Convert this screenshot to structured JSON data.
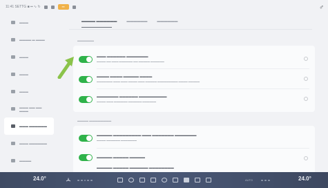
{
  "statusbar": {
    "left_text": "11:41 SETTG ■ ▪▪  ∿  ↻",
    "badge": "▪▪▪",
    "right_icon": "person-icon",
    "right_glyph": "♂"
  },
  "sidebar": {
    "items": [
      {
        "label": "▬▬▬",
        "icon": "info-icon"
      },
      {
        "label": "▬▬▬▬ ▬ ▬▬▬",
        "icon": "display-icon"
      },
      {
        "label": "▬▬▬",
        "icon": "light-icon"
      },
      {
        "label": "▬▬▬",
        "icon": "seat-icon"
      },
      {
        "label": "▬▬▬",
        "icon": "lock-icon"
      },
      {
        "label": "▬▬▬ ▬▬ ▬▬ ▬▬▬",
        "icon": "steering-icon"
      },
      {
        "label": "▬▬▬ ▬▬▬▬▬▬",
        "icon": "assist-icon"
      },
      {
        "label": "▬▬▬ ▬▬▬▬▬▬",
        "icon": "energy-icon"
      },
      {
        "label": "▬▬▬▬",
        "icon": "system-icon"
      }
    ],
    "selected_index": 6
  },
  "tabs": [
    {
      "label": "▬▬▬▬ ▬▬▬▬▬▬"
    },
    {
      "label": "▬▬▬▬▬▬"
    },
    {
      "label": "▬▬▬▬▬▬"
    }
  ],
  "groups": [
    {
      "title": "▬▬▬▬▬▬",
      "rows": [
        {
          "title": "▬▬▬ ▬▬▬▬▬▬ ▬▬▬▬▬▬▬",
          "subtitle": "▬▬▬▬ ▬▬ ▬▬▬ ▬▬▬▬▬▬ ▬▬ ▬▬▬▬▬ ▬▬▬▬▬▬",
          "enabled": true
        },
        {
          "title": "▬▬▬▬ ▬▬▬▬ ▬▬▬▬▬ ▬▬▬▬",
          "subtitle": "▬▬▬▬▬▬▬ ▬▬▬ ▬▬▬ ▬▬▬▬ ▬▬▬ ▬▬▬▬▬ ▬▬▬▬▬▬▬▬▬ ▬▬▬▬ ▬▬▬▬▬",
          "enabled": true
        },
        {
          "title": "▬▬▬▬▬▬▬ ▬▬▬▬▬▬ ▬▬▬▬▬▬▬▬▬",
          "subtitle": "▬▬▬▬ ▬▬▬ ▬▬▬▬▬▬ ▬▬▬▬▬▬ ▬▬▬▬▬▬",
          "enabled": true
        }
      ]
    },
    {
      "title": "▬▬▬▬ ▬▬▬▬▬▬▬▬",
      "rows": [
        {
          "title": "▬▬▬▬▬ ▬▬▬▬▬▬▬▬▬ ▬▬▬ ▬▬▬▬▬▬▬ ▬▬▬▬▬▬▬",
          "subtitle": "▬▬▬▬ ▬▬▬▬▬▬ ▬▬▬▬▬▬▬",
          "enabled": true
        },
        {
          "title": "▬▬▬▬▬ ▬▬▬▬▬ ▬▬▬▬▬",
          "subtitle": "",
          "enabled": true
        }
      ],
      "trailing_title": "▬▬▬▬▬ ▬▬▬▬▬ ▬▬▬▬▬▬ ▬▬▬▬▬▬▬▬"
    }
  ],
  "dock": {
    "left_temp": "24.0°",
    "right_temp": "24.0°",
    "fan_label": "AUTO",
    "icons": [
      "car-icon",
      "phone-icon",
      "media-icon",
      "music-icon",
      "navigation-icon",
      "climate-icon",
      "apps-icon",
      "seat-heat-icon",
      "defrost-icon"
    ]
  },
  "colors": {
    "accent": "#2fb24a",
    "pointer": "#8bc34a",
    "dock": "#46526c"
  }
}
